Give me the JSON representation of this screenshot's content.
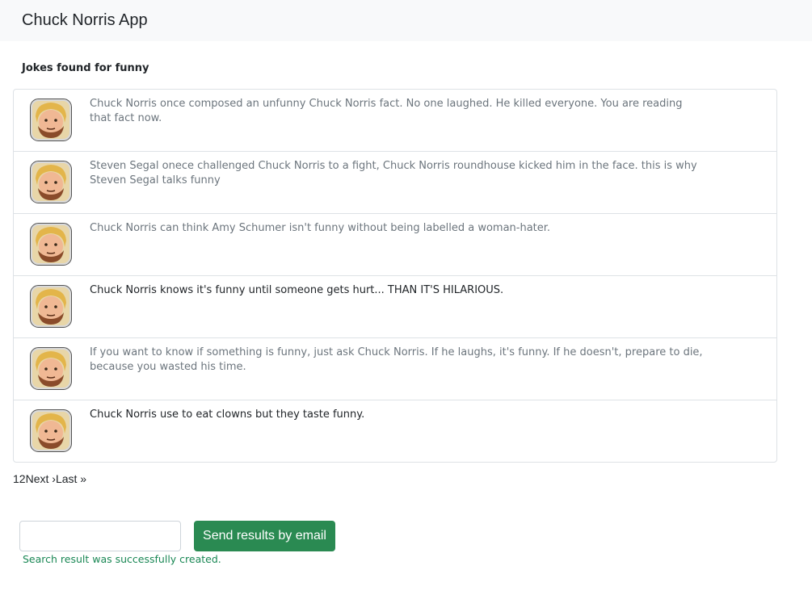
{
  "navbar": {
    "brand": "Chuck Norris App"
  },
  "results": {
    "heading": "Jokes found for funny"
  },
  "jokes": [
    {
      "text": "Chuck Norris once composed an unfunny Chuck Norris fact. No one laughed. He killed everyone. You are reading that fact now."
    },
    {
      "text": "Steven Segal onece challenged Chuck Norris to a fight, Chuck Norris roundhouse kicked him in the face. this is why Steven Segal talks funny"
    },
    {
      "text": "Chuck Norris can think Amy Schumer isn't funny without being labelled a woman-hater."
    },
    {
      "text": "Chuck Norris knows it's funny until someone gets hurt... THAN IT'S HILARIOUS."
    },
    {
      "text": "If you want to know if something is funny, just ask Chuck Norris. If he laughs, it's funny. If he doesn't, prepare to die, because you wasted his time."
    },
    {
      "text": "Chuck Norris use to eat clowns but they taste funny."
    }
  ],
  "pagination": {
    "page1": "1",
    "page2": "2",
    "next": "Next ›",
    "last": "Last »"
  },
  "email": {
    "value": "",
    "placeholder": "",
    "button_label": "Send results by email"
  },
  "status": {
    "message": "Search result was successfully created."
  },
  "icons": {
    "avatar": "chuck-norris-avatar-icon"
  },
  "colors": {
    "button": "#2a8a52",
    "status": "#198754",
    "navbar": "#f8f9fa"
  }
}
